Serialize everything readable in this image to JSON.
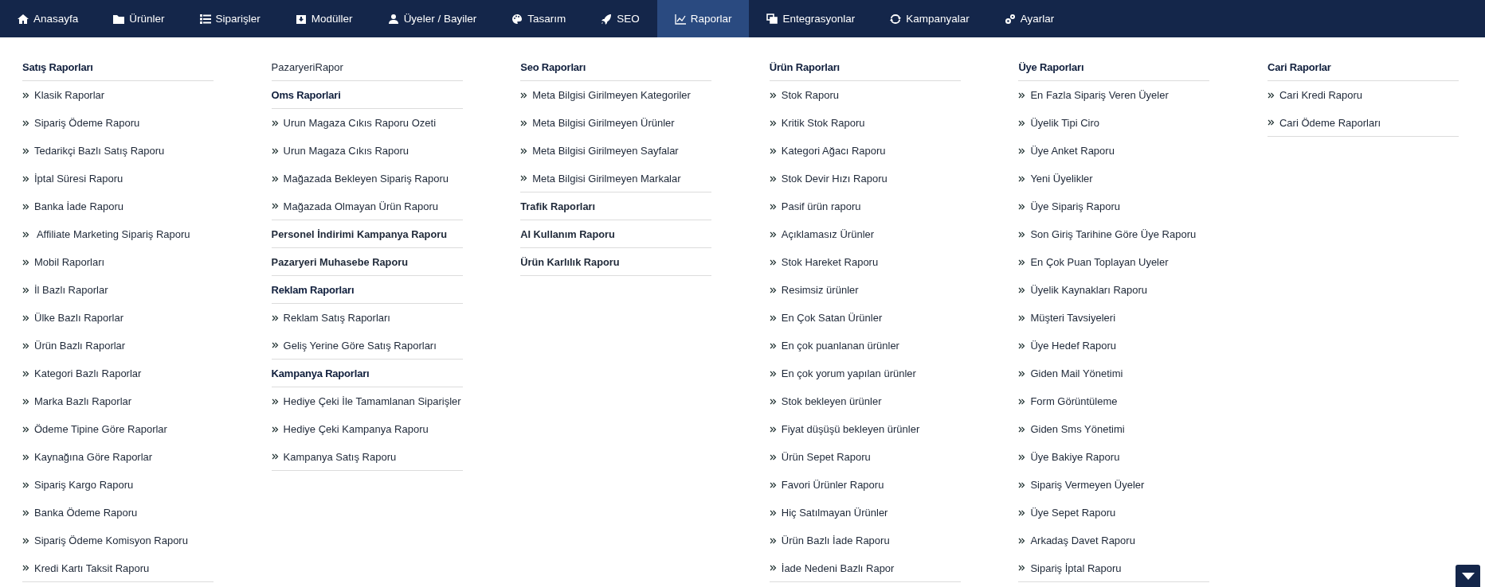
{
  "nav": {
    "items": [
      {
        "label": "Anasayfa",
        "selected": false
      },
      {
        "label": "Ürünler",
        "selected": false
      },
      {
        "label": "Siparişler",
        "selected": false
      },
      {
        "label": "Modüller",
        "selected": false
      },
      {
        "label": "Üyeler / Bayiler",
        "selected": false
      },
      {
        "label": "Tasarım",
        "selected": false
      },
      {
        "label": "SEO",
        "selected": false
      },
      {
        "label": "Raporlar",
        "selected": true
      },
      {
        "label": "Entegrasyonlar",
        "selected": false
      },
      {
        "label": "Kampanyalar",
        "selected": false
      },
      {
        "label": "Ayarlar",
        "selected": false
      }
    ]
  },
  "columns": [
    {
      "entries": [
        {
          "kind": "title",
          "text": "Satış Raporları"
        },
        {
          "kind": "link",
          "text": "Klasik Raporlar"
        },
        {
          "kind": "link",
          "text": "Sipariş Ödeme Raporu"
        },
        {
          "kind": "link",
          "text": "Tedarikçi Bazlı Satış Raporu"
        },
        {
          "kind": "link",
          "text": "İptal Süresi Raporu"
        },
        {
          "kind": "link",
          "text": "Banka İade Raporu"
        },
        {
          "kind": "link",
          "text": " Affiliate Marketing Sipariş Raporu"
        },
        {
          "kind": "link",
          "text": "Mobil Raporları"
        },
        {
          "kind": "link",
          "text": "İl Bazlı Raporlar"
        },
        {
          "kind": "link",
          "text": "Ülke Bazlı Raporlar"
        },
        {
          "kind": "link",
          "text": "Ürün Bazlı Raporlar"
        },
        {
          "kind": "link",
          "text": "Kategori Bazlı Raporlar"
        },
        {
          "kind": "link",
          "text": "Marka Bazlı Raporlar"
        },
        {
          "kind": "link",
          "text": "Ödeme Tipine Göre Raporlar"
        },
        {
          "kind": "link",
          "text": "Kaynağına Göre Raporlar"
        },
        {
          "kind": "link",
          "text": "Sipariş Kargo Raporu"
        },
        {
          "kind": "link",
          "text": "Banka Ödeme Raporu"
        },
        {
          "kind": "link",
          "text": "Sipariş Ödeme Komisyon Raporu"
        },
        {
          "kind": "link",
          "text": "Kredi Kartı Taksit Raporu"
        }
      ]
    },
    {
      "entries": [
        {
          "kind": "plain",
          "text": "PazaryeriRapor"
        },
        {
          "kind": "title",
          "text": "Oms Raporlari"
        },
        {
          "kind": "link",
          "text": "Urun Magaza Cıkıs Raporu Ozeti"
        },
        {
          "kind": "link",
          "text": "Urun Magaza Cıkıs Raporu"
        },
        {
          "kind": "link",
          "text": "Mağazada Bekleyen Sipariş Raporu"
        },
        {
          "kind": "link",
          "text": "Mağazada Olmayan Ürün Raporu"
        },
        {
          "kind": "section",
          "text": "Personel İndirimi Kampanya Raporu"
        },
        {
          "kind": "section",
          "text": "Pazaryeri Muhasebe Raporu"
        },
        {
          "kind": "title",
          "text": "Reklam Raporları"
        },
        {
          "kind": "link",
          "text": "Reklam Satış Raporları"
        },
        {
          "kind": "link",
          "text": "Geliş Yerine Göre Satış Raporları"
        },
        {
          "kind": "title",
          "text": "Kampanya Raporları"
        },
        {
          "kind": "link",
          "text": "Hediye Çeki İle Tamamlanan Siparişler"
        },
        {
          "kind": "link",
          "text": "Hediye Çeki Kampanya Raporu"
        },
        {
          "kind": "link",
          "text": "Kampanya Satış Raporu"
        }
      ]
    },
    {
      "entries": [
        {
          "kind": "title",
          "text": "Seo Raporları"
        },
        {
          "kind": "link",
          "text": "Meta Bilgisi Girilmeyen Kategoriler"
        },
        {
          "kind": "link",
          "text": "Meta Bilgisi Girilmeyen Ürünler"
        },
        {
          "kind": "link",
          "text": "Meta Bilgisi Girilmeyen Sayfalar"
        },
        {
          "kind": "link",
          "text": "Meta Bilgisi Girilmeyen Markalar"
        },
        {
          "kind": "section",
          "text": "Trafik Raporları"
        },
        {
          "kind": "section",
          "text": "AI Kullanım Raporu"
        },
        {
          "kind": "section",
          "text": "Ürün Karlılık Raporu"
        }
      ]
    },
    {
      "entries": [
        {
          "kind": "title",
          "text": "Ürün Raporları"
        },
        {
          "kind": "link",
          "text": "Stok Raporu"
        },
        {
          "kind": "link",
          "text": "Kritik Stok Raporu"
        },
        {
          "kind": "link",
          "text": "Kategori Ağacı Raporu"
        },
        {
          "kind": "link",
          "text": "Stok Devir Hızı Raporu"
        },
        {
          "kind": "link",
          "text": "Pasif ürün raporu"
        },
        {
          "kind": "link",
          "text": "Açıklamasız Ürünler"
        },
        {
          "kind": "link",
          "text": "Stok Hareket Raporu"
        },
        {
          "kind": "link",
          "text": "Resimsiz ürünler"
        },
        {
          "kind": "link",
          "text": "En Çok Satan Ürünler"
        },
        {
          "kind": "link",
          "text": "En çok puanlanan ürünler"
        },
        {
          "kind": "link",
          "text": "En çok yorum yapılan ürünler"
        },
        {
          "kind": "link",
          "text": "Stok bekleyen ürünler"
        },
        {
          "kind": "link",
          "text": "Fiyat düşüşü bekleyen ürünler"
        },
        {
          "kind": "link",
          "text": "Ürün Sepet Raporu"
        },
        {
          "kind": "link",
          "text": "Favori Ürünler Raporu"
        },
        {
          "kind": "link",
          "text": "Hiç Satılmayan Ürünler"
        },
        {
          "kind": "link",
          "text": "Ürün Bazlı İade Raporu"
        },
        {
          "kind": "link",
          "text": "İade Nedeni Bazlı Rapor"
        }
      ]
    },
    {
      "entries": [
        {
          "kind": "title",
          "text": "Üye Raporları"
        },
        {
          "kind": "link",
          "text": "En Fazla Sipariş Veren Üyeler"
        },
        {
          "kind": "link",
          "text": "Üyelik Tipi Ciro"
        },
        {
          "kind": "link",
          "text": "Üye Anket Raporu"
        },
        {
          "kind": "link",
          "text": "Yeni Üyelikler"
        },
        {
          "kind": "link",
          "text": "Üye Sipariş Raporu"
        },
        {
          "kind": "link",
          "text": "Son Giriş Tarihine Göre Üye Raporu"
        },
        {
          "kind": "link",
          "text": "En Çok Puan Toplayan Uyeler"
        },
        {
          "kind": "link",
          "text": "Üyelik Kaynakları Raporu"
        },
        {
          "kind": "link",
          "text": "Müşteri Tavsiyeleri"
        },
        {
          "kind": "link",
          "text": "Üye Hedef Raporu"
        },
        {
          "kind": "link",
          "text": "Giden Mail Yönetimi"
        },
        {
          "kind": "link",
          "text": "Form Görüntüleme"
        },
        {
          "kind": "link",
          "text": "Giden Sms Yönetimi"
        },
        {
          "kind": "link",
          "text": "Üye Bakiye Raporu"
        },
        {
          "kind": "link",
          "text": "Sipariş Vermeyen Üyeler"
        },
        {
          "kind": "link",
          "text": "Üye Sepet Raporu"
        },
        {
          "kind": "link",
          "text": "Arkadaş Davet Raporu"
        },
        {
          "kind": "link",
          "text": "Sipariş İptal Raporu"
        }
      ]
    },
    {
      "entries": [
        {
          "kind": "title",
          "text": "Cari Raporlar"
        },
        {
          "kind": "link",
          "text": "Cari Kredi Raporu"
        },
        {
          "kind": "link",
          "text": "Cari Ödeme Raporları"
        }
      ]
    }
  ]
}
